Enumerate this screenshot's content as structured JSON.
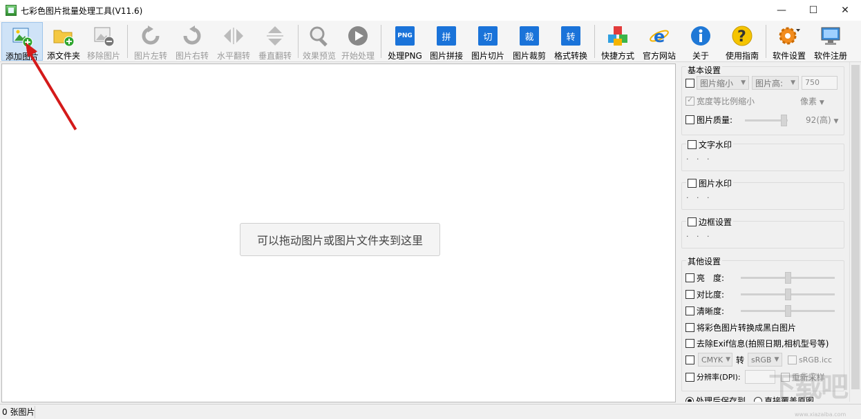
{
  "window": {
    "title": "七彩色图片批量处理工具(V11.6)",
    "minimize": "—",
    "maximize": "☐",
    "close": "✕"
  },
  "toolbar": {
    "add_image": "添加图片",
    "add_folder": "添文件夹",
    "remove_image": "移除图片",
    "rotate_left": "图片左转",
    "rotate_right": "图片右转",
    "flip_horizontal": "水平翻转",
    "flip_vertical": "垂直翻转",
    "preview": "效果预览",
    "start": "开始处理",
    "process_png": "处理PNG",
    "png_icon_text": "PNG",
    "stitch": "图片拼接",
    "stitch_icon_text": "拼",
    "slice": "图片切片",
    "slice_icon_text": "切",
    "crop": "图片裁剪",
    "crop_icon_text": "裁",
    "convert": "格式转换",
    "convert_icon_text": "转",
    "shortcut": "快捷方式",
    "website": "官方网站",
    "about": "关于",
    "guide": "使用指南",
    "settings": "软件设置",
    "register": "软件注册"
  },
  "main": {
    "drop_hint": "可以拖动图片或图片文件夹到这里"
  },
  "panel": {
    "basic": {
      "title": "基本设置",
      "resize_mode": "图片缩小",
      "dimension": "图片高:",
      "dimension_value": "750",
      "keep_ratio": "宽度等比例缩小",
      "unit": "像素",
      "quality_label": "图片质量:",
      "quality_value": "92(高)"
    },
    "text_watermark": {
      "title": "文字水印",
      "dots": "· · ·"
    },
    "image_watermark": {
      "title": "图片水印",
      "dots": "· · ·"
    },
    "border": {
      "title": "边框设置",
      "dots": "· · ·"
    },
    "other": {
      "title": "其他设置",
      "brightness": "亮　度:",
      "contrast": "对比度:",
      "sharpness": "清晰度:",
      "grayscale": "将彩色图片转换成黑白图片",
      "remove_exif": "去除Exif信息(拍照日期,相机型号等)",
      "color_from": "CMYK",
      "to_label": "转",
      "color_to": "sRGB",
      "icc": "sRGB.icc",
      "dpi_label": "分辨率(DPI):",
      "resample": "重新采样"
    },
    "output": {
      "save_to": "处理后保存到",
      "overwrite": "直接覆盖原图"
    }
  },
  "status": {
    "count": "0 张图片"
  },
  "watermark": {
    "text": "下载吧",
    "sub": "www.xiazaiba.com"
  }
}
